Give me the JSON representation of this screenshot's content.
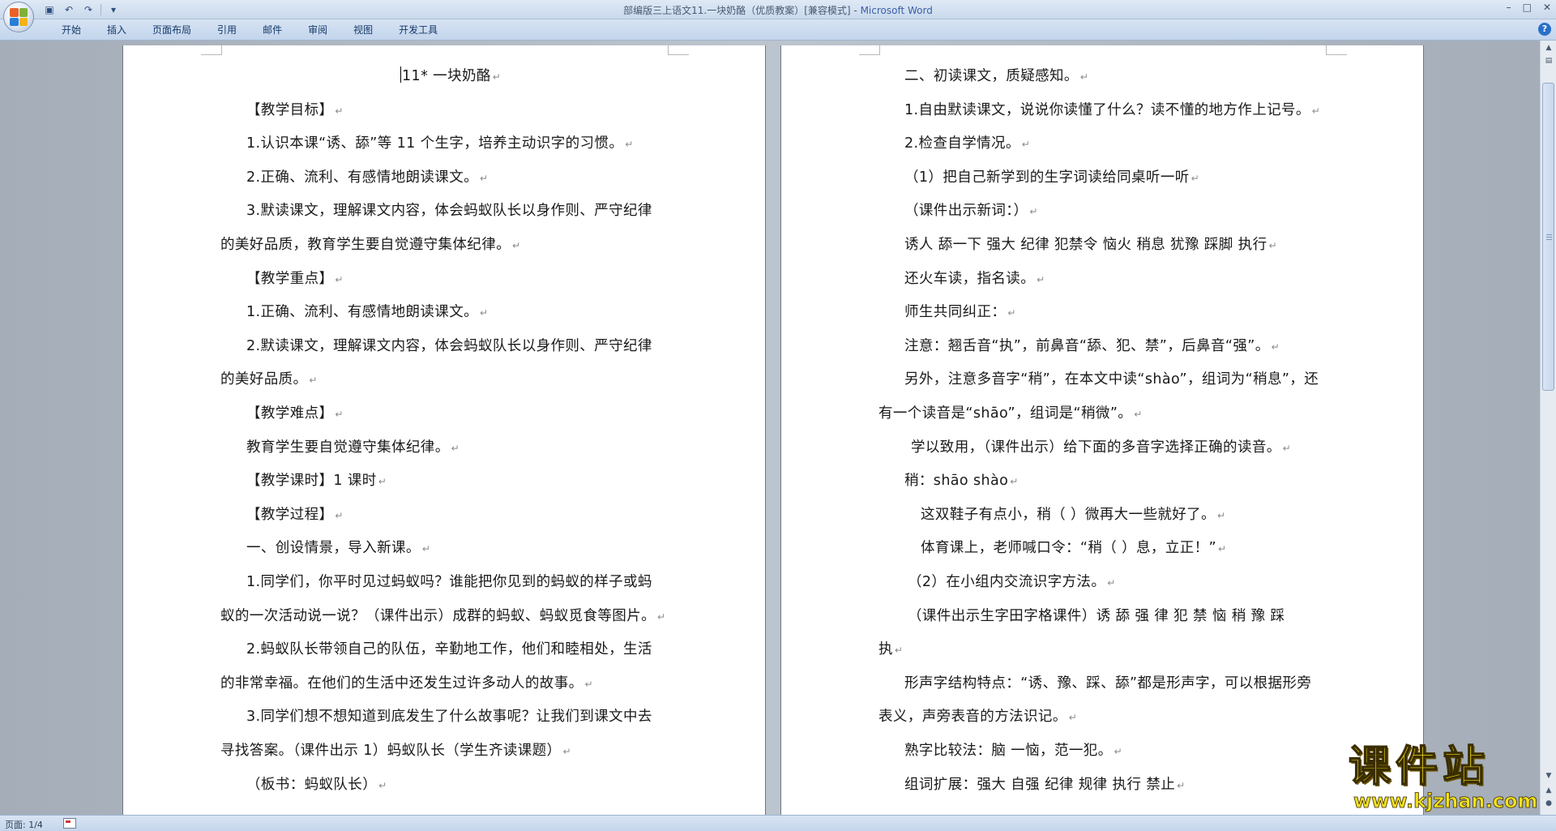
{
  "window": {
    "title": "部编版三上语文11.一块奶酪（优质教案）[兼容模式] - ",
    "app_name": "Microsoft Word",
    "controls": [
      "–",
      "□",
      "✕"
    ]
  },
  "quick_access": {
    "icons": [
      "save-icon",
      "undo-icon",
      "redo-icon",
      "customize-icon"
    ],
    "glyphs": [
      "▣",
      "↶",
      "↷",
      "▾"
    ]
  },
  "ribbon": {
    "tabs": [
      "开始",
      "插入",
      "页面布局",
      "引用",
      "邮件",
      "审阅",
      "视图",
      "开发工具"
    ],
    "help": "?"
  },
  "document": {
    "left_page": [
      {
        "text": "11*  一块奶酪",
        "mark": "↵"
      },
      {
        "text": "【教学目标】",
        "mark": "↵"
      },
      {
        "text": "1.认识本课“诱、舔”等 11 个生字，培养主动识字的习惯。",
        "mark": "↵"
      },
      {
        "text": "2.正确、流利、有感情地朗读课文。",
        "mark": "↵"
      },
      {
        "text": "3.默读课文，理解课文内容，体会蚂蚁队长以身作则、严守纪律",
        "mark": ""
      },
      {
        "text": "的美好品质，教育学生要自觉遵守集体纪律。",
        "mark": "↵"
      },
      {
        "text": "【教学重点】",
        "mark": "↵"
      },
      {
        "text": "1.正确、流利、有感情地朗读课文。",
        "mark": "↵"
      },
      {
        "text": "2.默读课文，理解课文内容，体会蚂蚁队长以身作则、严守纪律",
        "mark": ""
      },
      {
        "text": "的美好品质。",
        "mark": "↵"
      },
      {
        "text": "【教学难点】",
        "mark": "↵"
      },
      {
        "text": "教育学生要自觉遵守集体纪律。",
        "mark": "↵"
      },
      {
        "text": "【教学课时】1 课时",
        "mark": "↵"
      },
      {
        "text": "【教学过程】",
        "mark": "↵"
      },
      {
        "text": "一、创设情景，导入新课。",
        "mark": "↵"
      },
      {
        "text": "1.同学们，你平时见过蚂蚁吗？谁能把你见到的蚂蚁的样子或蚂",
        "mark": ""
      },
      {
        "text": "蚁的一次活动说一说？（课件出示）成群的蚂蚁、蚂蚁觅食等图片。",
        "mark": "↵"
      },
      {
        "text": "2.蚂蚁队长带领自己的队伍，辛勤地工作，他们和睦相处，生活",
        "mark": ""
      },
      {
        "text": "的非常幸福。在他们的生活中还发生过许多动人的故事。",
        "mark": "↵"
      },
      {
        "text": "3.同学们想不想知道到底发生了什么故事呢？让我们到课文中去",
        "mark": ""
      },
      {
        "text": "寻找答案。（课件出示 1）蚂蚁队长（学生齐读课题）",
        "mark": "↵"
      },
      {
        "text": "（板书：蚂蚁队长）",
        "mark": "↵"
      }
    ],
    "right_page": [
      {
        "text": "二、初读课文，质疑感知。",
        "mark": "↵"
      },
      {
        "text": "1.自由默读课文，说说你读懂了什么？读不懂的地方作上记号。",
        "mark": "↵"
      },
      {
        "text": "2.检查自学情况。",
        "mark": "↵"
      },
      {
        "text": "（1）把自己新学到的生字词读给同桌听一听",
        "mark": "↵"
      },
      {
        "text": "（课件出示新词：）",
        "mark": "↵"
      },
      {
        "text": "诱人  舔一下  强大  纪律  犯禁令  恼火  稍息  犹豫  踩脚  执行",
        "mark": "↵"
      },
      {
        "text": "还火车读，指名读。",
        "mark": "↵"
      },
      {
        "text": "师生共同纠正：",
        "mark": "↵"
      },
      {
        "text": "注意：翘舌音“执”，前鼻音“舔、犯、禁”，后鼻音“强”。",
        "mark": "↵"
      },
      {
        "text": "另外，注意多音字“稍”，在本文中读“shào”，组词为“稍息”，还",
        "mark": ""
      },
      {
        "text": "有一个读音是“shāo”，组词是“稍微”。",
        "mark": "↵"
      },
      {
        "text": "学以致用，（课件出示）给下面的多音字选择正确的读音。",
        "mark": "↵"
      },
      {
        "text": "稍：shāo shào",
        "mark": "↵"
      },
      {
        "text": "这双鞋子有点小，稍（        ）微再大一些就好了。",
        "mark": "↵"
      },
      {
        "text": "体育课上，老师喊口令：“稍（     ）息，立正！”",
        "mark": "↵"
      },
      {
        "text": "（2）在小组内交流识字方法。",
        "mark": "↵"
      },
      {
        "text": "（课件出示生字田字格课件）诱  舔  强  律  犯  禁  恼  稍  豫  踩",
        "mark": ""
      },
      {
        "text": "执",
        "mark": "↵"
      },
      {
        "text": "形声字结构特点：“诱、豫、踩、舔”都是形声字，可以根据形旁",
        "mark": ""
      },
      {
        "text": "表义，声旁表音的方法识记。",
        "mark": "↵"
      },
      {
        "text": "熟字比较法：脑 一恼，范一犯。",
        "mark": "↵"
      },
      {
        "text": "组词扩展：强大  自强  纪律  规律  执行  禁止",
        "mark": "↵"
      }
    ]
  },
  "status": {
    "page": "页面: 1/4"
  },
  "watermark": {
    "main": "课件站",
    "url": "www.kjzhan.com"
  },
  "colors": {
    "title_bar": "#c9d9ec",
    "workspace": "#a4adb8",
    "page": "#ffffff",
    "app_name": "#3a5fa8",
    "watermark": "#f2e01c"
  }
}
